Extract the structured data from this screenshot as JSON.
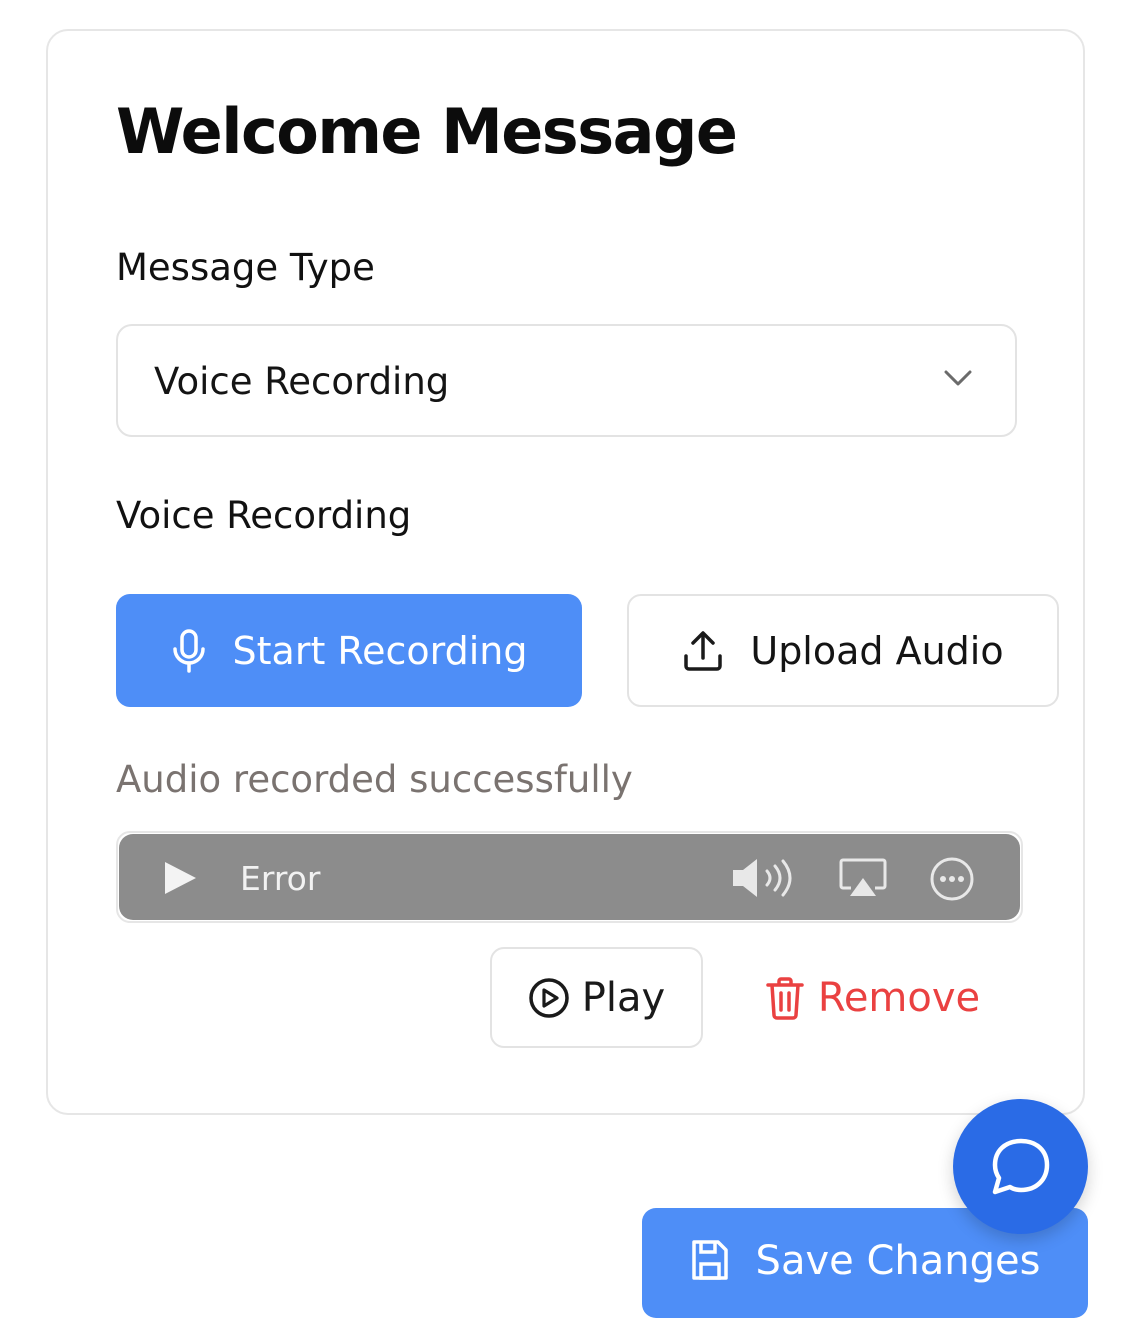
{
  "card": {
    "title": "Welcome Message"
  },
  "message_type": {
    "label": "Message Type",
    "selected": "Voice Recording",
    "icon": "chevron-down-icon"
  },
  "voice_recording": {
    "label": "Voice Recording",
    "start_button": "Start Recording",
    "upload_button": "Upload Audio",
    "status": "Audio recorded successfully"
  },
  "audio_player": {
    "state_text": "Error"
  },
  "actions": {
    "play_label": "Play",
    "remove_label": "Remove"
  },
  "footer": {
    "save_label": "Save Changes"
  },
  "colors": {
    "primary": "#4e8ef7",
    "fab": "#2a6be6",
    "danger": "#ea4141",
    "player_bg": "#8c8c8c",
    "muted_text": "#7a7370"
  }
}
